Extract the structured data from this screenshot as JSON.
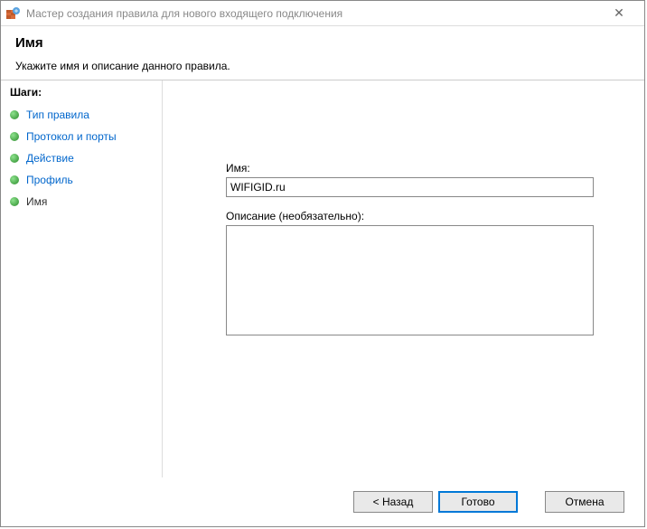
{
  "titlebar": {
    "title": "Мастер создания правила для нового входящего подключения"
  },
  "header": {
    "title": "Имя",
    "subtitle": "Укажите имя и описание данного правила."
  },
  "sidebar": {
    "steps_label": "Шаги:",
    "items": [
      {
        "label": "Тип правила"
      },
      {
        "label": "Протокол и порты"
      },
      {
        "label": "Действие"
      },
      {
        "label": "Профиль"
      },
      {
        "label": "Имя"
      }
    ]
  },
  "form": {
    "name_label": "Имя:",
    "name_value": "WIFIGID.ru",
    "desc_label": "Описание (необязательно):",
    "desc_value": ""
  },
  "footer": {
    "back": "< Назад",
    "finish": "Готово",
    "cancel": "Отмена"
  }
}
